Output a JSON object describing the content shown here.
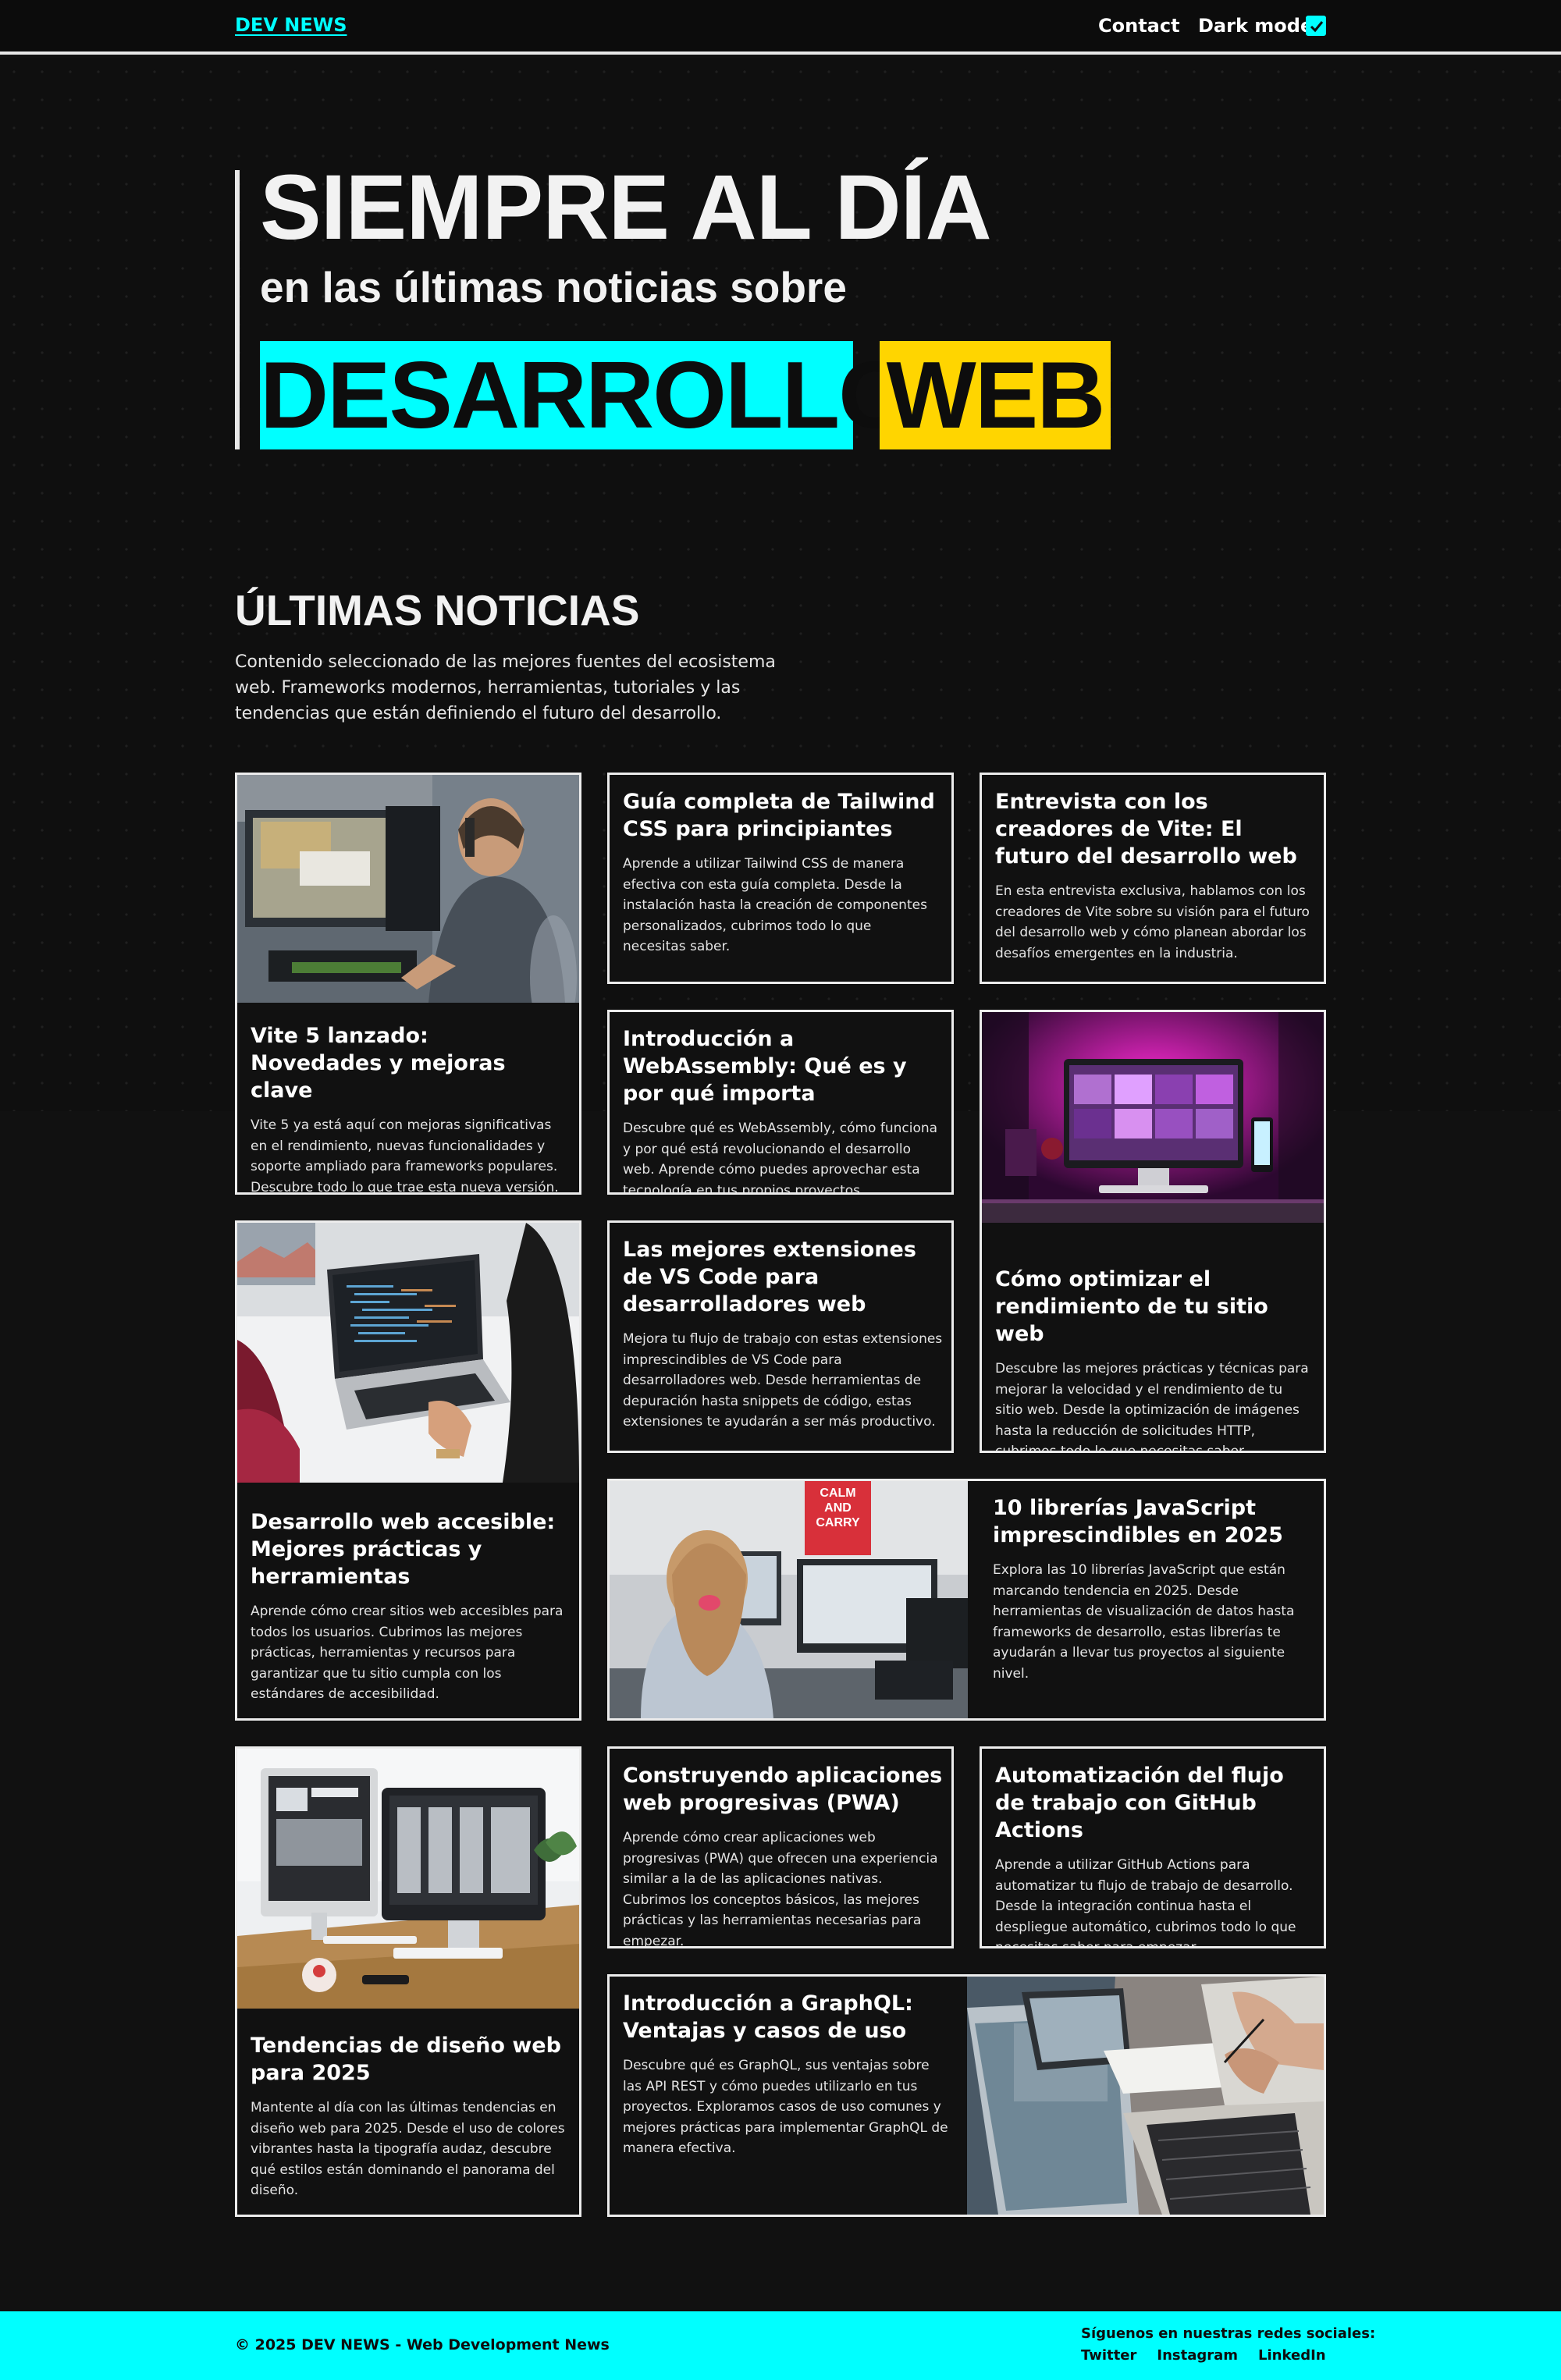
{
  "header": {
    "brand": "DEV NEWS",
    "contact": "Contact",
    "dark_mode_label": "Dark mode:",
    "dark_mode_checked": true
  },
  "hero": {
    "title": "SIEMPRE AL DÍA",
    "subtitle": "en las últimas noticias sobre",
    "tag_1": "DESARROLLO",
    "tag_2": "WEB",
    "colors": {
      "tag_1": "#00ffff",
      "tag_2": "#ffd500"
    }
  },
  "section": {
    "title": "ÚLTIMAS NOTICIAS",
    "description": "Contenido seleccionado de las mejores fuentes del ecosistema web. Frameworks modernos, herramientas, tutoriales y las tendencias que están definiendo el futuro del desarrollo."
  },
  "articles": [
    {
      "title": "Vite 5 lanzado: Novedades y mejoras clave",
      "text": "Vite 5 ya está aquí con mejoras significativas en el rendimiento, nuevas funcionalidades y soporte ampliado para frameworks populares. Descubre todo lo que trae esta nueva versión.",
      "image": "person-gaming-desk-photo"
    },
    {
      "title": "Guía completa de Tailwind CSS para principiantes",
      "text": "Aprende a utilizar Tailwind CSS de manera efectiva con esta guía completa. Desde la instalación hasta la creación de componentes personalizados, cubrimos todo lo que necesitas saber."
    },
    {
      "title": "Entrevista con los creadores de Vite: El futuro del desarrollo web",
      "text": "En esta entrevista exclusiva, hablamos con los creadores de Vite sobre su visión para el futuro del desarrollo web y cómo planean abordar los desafíos emergentes en la industria."
    },
    {
      "title": "Introducción a WebAssembly: Qué es y por qué importa",
      "text": "Descubre qué es WebAssembly, cómo funciona y por qué está revolucionando el desarrollo web. Aprende cómo puedes aprovechar esta tecnología en tus propios proyectos."
    },
    {
      "title": "Cómo optimizar el rendimiento de tu sitio web",
      "text": "Descubre las mejores prácticas y técnicas para mejorar la velocidad y el rendimiento de tu sitio web. Desde la optimización de imágenes hasta la reducción de solicitudes HTTP, cubrimos todo lo que necesitas saber.",
      "image": "pink-desk-setup-photo"
    },
    {
      "title": "Desarrollo web accesible: Mejores prácticas y herramientas",
      "text": "Aprende cómo crear sitios web accesibles para todos los usuarios. Cubrimos las mejores prácticas, herramientas y recursos para garantizar que tu sitio cumpla con los estándares de accesibilidad.",
      "image": "laptop-code-photo"
    },
    {
      "title": "Las mejores extensiones de VS Code para desarrolladores web",
      "text": "Mejora tu flujo de trabajo con estas extensiones imprescindibles de VS Code para desarrolladores web. Desde herramientas de depuración hasta snippets de código, estas extensiones te ayudarán a ser más productivo."
    },
    {
      "title": "10 librerías JavaScript imprescindibles en 2025",
      "text": "Explora las 10 librerías JavaScript que están marcando tendencia en 2025. Desde herramientas de visualización de datos hasta frameworks de desarrollo, estas librerías te ayudarán a llevar tus proyectos al siguiente nivel.",
      "image": "girl-at-computer-photo",
      "poster": "CALM\nAND\nCARRY"
    },
    {
      "title": "Tendencias de diseño web para 2025",
      "text": "Mantente al día con las últimas tendencias en diseño web para 2025. Desde el uso de colores vibrantes hasta la tipografía audaz, descubre qué estilos están dominando el panorama del diseño.",
      "image": "imac-desk-photo"
    },
    {
      "title": "Construyendo aplicaciones web progresivas (PWA)",
      "text": "Aprende cómo crear aplicaciones web progresivas (PWA) que ofrecen una experiencia similar a la de las aplicaciones nativas. Cubrimos los conceptos básicos, las mejores prácticas y las herramientas necesarias para empezar."
    },
    {
      "title": "Automatización del flujo de trabajo con GitHub Actions",
      "text": "Aprende a utilizar GitHub Actions para automatizar tu flujo de trabajo de desarrollo. Desde la integración continua hasta el despliegue automático, cubrimos todo lo que necesitas saber para empezar."
    },
    {
      "title": "Introducción a GraphQL: Ventajas y casos de uso",
      "text": "Descubre qué es GraphQL, sus ventajas sobre las API REST y cómo puedes utilizarlo en tus proyectos. Exploramos casos de uso comunes y mejores prácticas para implementar GraphQL de manera efectiva.",
      "image": "laptops-meeting-photo"
    }
  ],
  "footer": {
    "copyright": "© 2025 DEV NEWS - Web Development News",
    "follow": "Síguenos en nuestras redes sociales:",
    "links": [
      "Twitter",
      "Instagram",
      "LinkedIn"
    ],
    "color": "#00ffff"
  }
}
